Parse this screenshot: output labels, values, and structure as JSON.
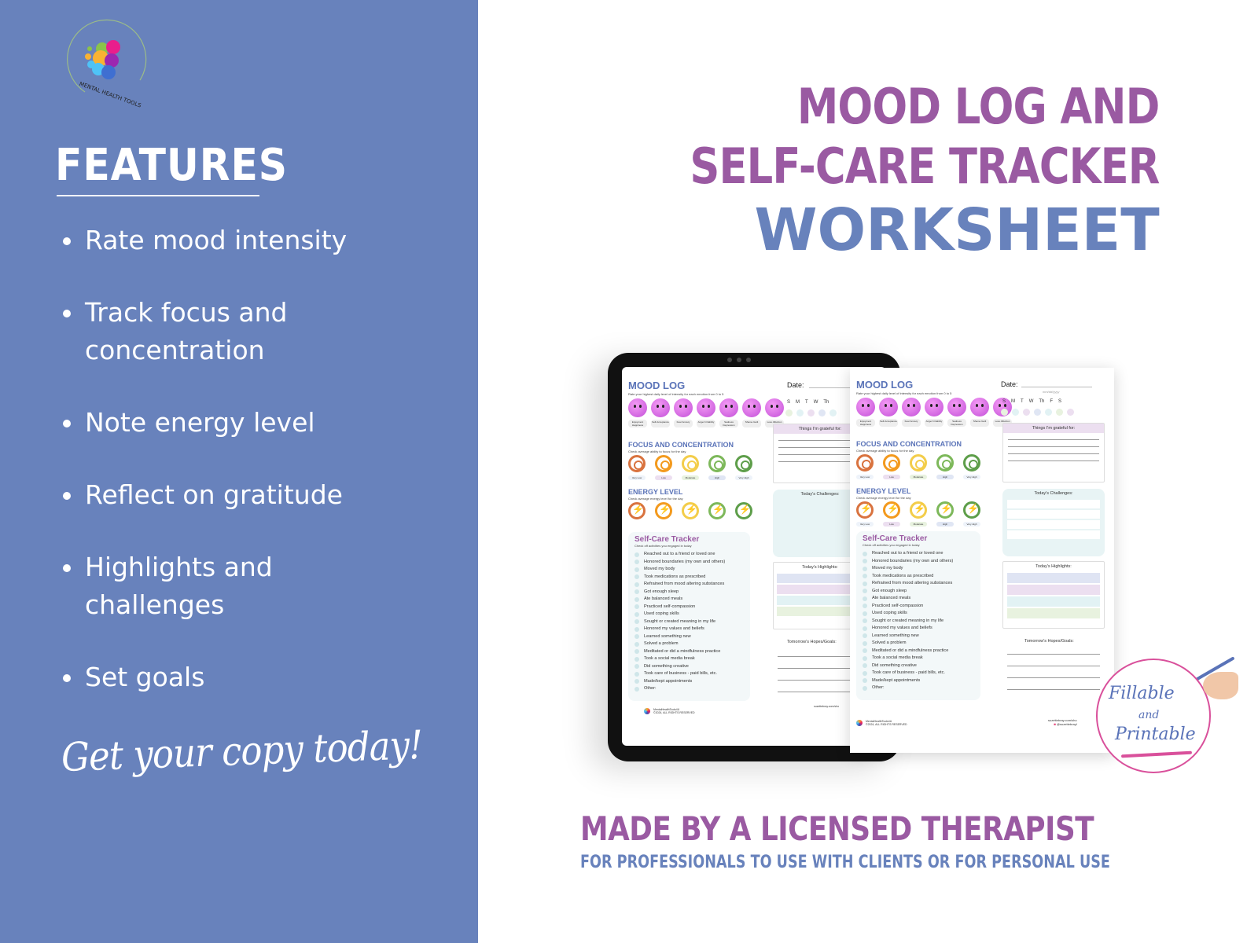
{
  "brand": {
    "logo_text": "MENTAL HEALTH TOOLS"
  },
  "features": {
    "title": "FEATURES",
    "items": [
      "Rate mood intensity",
      "Track focus and concentration",
      "Note energy level",
      "Reflect on gratitude",
      "Highlights and challenges",
      "Set goals"
    ],
    "cta": "Get your copy today!"
  },
  "headline": {
    "line1": "MOOD LOG AND",
    "line2": "SELF-CARE TRACKER",
    "line3": "WORKSHEET"
  },
  "worksheet": {
    "title": "MOOD LOG",
    "subtitle": "Rate your highest daily level of intensity for each emotion from 0 to 5",
    "emotions": [
      "Enjoyment Happiness",
      "Self-Acceptance",
      "Fear Anxiety",
      "Anger Irritability",
      "Sadness Depression",
      "Shame Guilt",
      "Love Affection"
    ],
    "focus_title": "FOCUS AND CONCENTRATION",
    "focus_sub": "Check average ability to focus for the day",
    "energy_title": "ENERGY LEVEL",
    "energy_sub": "Check average energy level for the day",
    "levels": [
      "Very Low",
      "Low",
      "Moderate",
      "High",
      "Very High"
    ],
    "level_colors": [
      "#d9733f",
      "#f39a1e",
      "#f3cd4a",
      "#7db85a",
      "#5e9e4a"
    ],
    "selfcare_title": "Self-Care Tracker",
    "selfcare_sub": "Check off activities you engaged in today",
    "selfcare_items": [
      "Reached out to a friend or loved one",
      "Honored boundaries (my own and others)",
      "Moved my body",
      "Took medications as prescribed",
      "Refrained from mood altering substances",
      "Got enough sleep",
      "Ate balanced meals",
      "Practiced self-compassion",
      "Used coping skills",
      "Sought or created meaning in my life",
      "Honored my values and beliefs",
      "Learned something new",
      "Solved a problem",
      "Meditated or did a mindfulness practice",
      "Took a social media break",
      "Did something creative",
      "Took care of business - paid bills, etc.",
      "Made/kept appointments",
      "Other:"
    ],
    "date_label": "Date:",
    "date_placeholder": "mm/dd/yyyy",
    "days": [
      "S",
      "M",
      "T",
      "W",
      "Th",
      "F",
      "S"
    ],
    "day_colors": [
      "#e8f2df",
      "#e2f2f4",
      "#ecdff0",
      "#e0e6f4",
      "#e2f2f4",
      "#e8f2df",
      "#ecdff0"
    ],
    "grateful": "Things I'm grateful for:",
    "challenges": "Today's Challenges:",
    "highlights": "Today's Highlights:",
    "highlight_colors": [
      "#dfe4f3",
      "#ecdff0",
      "#e2f2f4",
      "#e8f2df"
    ],
    "hopes": "Tomorrow's Hopes/Goals:",
    "footer_brand": "MentalHealthTools4U",
    "footer_copy": "©2024, ALL RIGHTS RESERVED",
    "footer_site": "suzettebray.com/sho",
    "footer_handle": "@suzettebrayl"
  },
  "badge": {
    "line1": "Fillable",
    "line2": "and",
    "line3": "Printable"
  },
  "bottom": {
    "made_by": "MADE BY A LICENSED THERAPIST",
    "for_whom": "FOR PROFESSIONALS TO USE WITH CLIENTS OR FOR PERSONAL USE"
  }
}
